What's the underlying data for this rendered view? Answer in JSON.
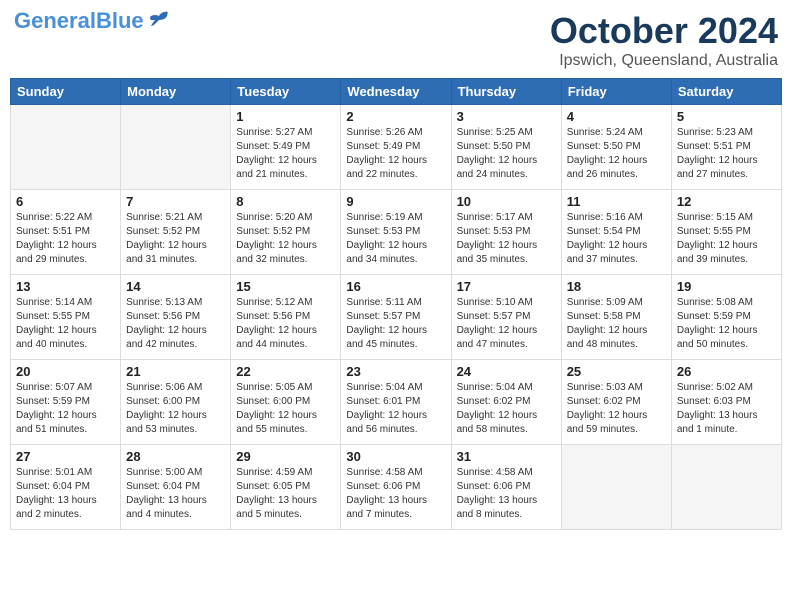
{
  "header": {
    "logo_general": "General",
    "logo_blue": "Blue",
    "month": "October 2024",
    "location": "Ipswich, Queensland, Australia"
  },
  "weekdays": [
    "Sunday",
    "Monday",
    "Tuesday",
    "Wednesday",
    "Thursday",
    "Friday",
    "Saturday"
  ],
  "weeks": [
    [
      {
        "day": "",
        "content": ""
      },
      {
        "day": "",
        "content": ""
      },
      {
        "day": "1",
        "content": "Sunrise: 5:27 AM\nSunset: 5:49 PM\nDaylight: 12 hours and 21 minutes."
      },
      {
        "day": "2",
        "content": "Sunrise: 5:26 AM\nSunset: 5:49 PM\nDaylight: 12 hours and 22 minutes."
      },
      {
        "day": "3",
        "content": "Sunrise: 5:25 AM\nSunset: 5:50 PM\nDaylight: 12 hours and 24 minutes."
      },
      {
        "day": "4",
        "content": "Sunrise: 5:24 AM\nSunset: 5:50 PM\nDaylight: 12 hours and 26 minutes."
      },
      {
        "day": "5",
        "content": "Sunrise: 5:23 AM\nSunset: 5:51 PM\nDaylight: 12 hours and 27 minutes."
      }
    ],
    [
      {
        "day": "6",
        "content": "Sunrise: 5:22 AM\nSunset: 5:51 PM\nDaylight: 12 hours and 29 minutes."
      },
      {
        "day": "7",
        "content": "Sunrise: 5:21 AM\nSunset: 5:52 PM\nDaylight: 12 hours and 31 minutes."
      },
      {
        "day": "8",
        "content": "Sunrise: 5:20 AM\nSunset: 5:52 PM\nDaylight: 12 hours and 32 minutes."
      },
      {
        "day": "9",
        "content": "Sunrise: 5:19 AM\nSunset: 5:53 PM\nDaylight: 12 hours and 34 minutes."
      },
      {
        "day": "10",
        "content": "Sunrise: 5:17 AM\nSunset: 5:53 PM\nDaylight: 12 hours and 35 minutes."
      },
      {
        "day": "11",
        "content": "Sunrise: 5:16 AM\nSunset: 5:54 PM\nDaylight: 12 hours and 37 minutes."
      },
      {
        "day": "12",
        "content": "Sunrise: 5:15 AM\nSunset: 5:55 PM\nDaylight: 12 hours and 39 minutes."
      }
    ],
    [
      {
        "day": "13",
        "content": "Sunrise: 5:14 AM\nSunset: 5:55 PM\nDaylight: 12 hours and 40 minutes."
      },
      {
        "day": "14",
        "content": "Sunrise: 5:13 AM\nSunset: 5:56 PM\nDaylight: 12 hours and 42 minutes."
      },
      {
        "day": "15",
        "content": "Sunrise: 5:12 AM\nSunset: 5:56 PM\nDaylight: 12 hours and 44 minutes."
      },
      {
        "day": "16",
        "content": "Sunrise: 5:11 AM\nSunset: 5:57 PM\nDaylight: 12 hours and 45 minutes."
      },
      {
        "day": "17",
        "content": "Sunrise: 5:10 AM\nSunset: 5:57 PM\nDaylight: 12 hours and 47 minutes."
      },
      {
        "day": "18",
        "content": "Sunrise: 5:09 AM\nSunset: 5:58 PM\nDaylight: 12 hours and 48 minutes."
      },
      {
        "day": "19",
        "content": "Sunrise: 5:08 AM\nSunset: 5:59 PM\nDaylight: 12 hours and 50 minutes."
      }
    ],
    [
      {
        "day": "20",
        "content": "Sunrise: 5:07 AM\nSunset: 5:59 PM\nDaylight: 12 hours and 51 minutes."
      },
      {
        "day": "21",
        "content": "Sunrise: 5:06 AM\nSunset: 6:00 PM\nDaylight: 12 hours and 53 minutes."
      },
      {
        "day": "22",
        "content": "Sunrise: 5:05 AM\nSunset: 6:00 PM\nDaylight: 12 hours and 55 minutes."
      },
      {
        "day": "23",
        "content": "Sunrise: 5:04 AM\nSunset: 6:01 PM\nDaylight: 12 hours and 56 minutes."
      },
      {
        "day": "24",
        "content": "Sunrise: 5:04 AM\nSunset: 6:02 PM\nDaylight: 12 hours and 58 minutes."
      },
      {
        "day": "25",
        "content": "Sunrise: 5:03 AM\nSunset: 6:02 PM\nDaylight: 12 hours and 59 minutes."
      },
      {
        "day": "26",
        "content": "Sunrise: 5:02 AM\nSunset: 6:03 PM\nDaylight: 13 hours and 1 minute."
      }
    ],
    [
      {
        "day": "27",
        "content": "Sunrise: 5:01 AM\nSunset: 6:04 PM\nDaylight: 13 hours and 2 minutes."
      },
      {
        "day": "28",
        "content": "Sunrise: 5:00 AM\nSunset: 6:04 PM\nDaylight: 13 hours and 4 minutes."
      },
      {
        "day": "29",
        "content": "Sunrise: 4:59 AM\nSunset: 6:05 PM\nDaylight: 13 hours and 5 minutes."
      },
      {
        "day": "30",
        "content": "Sunrise: 4:58 AM\nSunset: 6:06 PM\nDaylight: 13 hours and 7 minutes."
      },
      {
        "day": "31",
        "content": "Sunrise: 4:58 AM\nSunset: 6:06 PM\nDaylight: 13 hours and 8 minutes."
      },
      {
        "day": "",
        "content": ""
      },
      {
        "day": "",
        "content": ""
      }
    ]
  ]
}
